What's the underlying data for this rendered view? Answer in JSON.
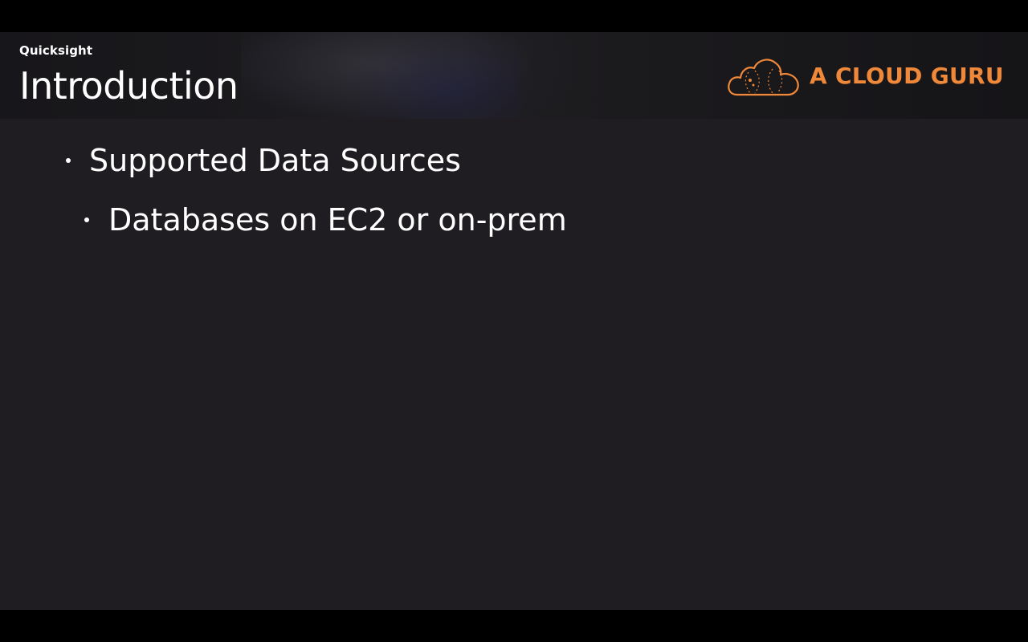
{
  "slide": {
    "course": "Quicksight",
    "title": "Introduction",
    "brand": {
      "name": "A CLOUD GURU",
      "icon": "cloud-logo-icon",
      "color": "#f0883a"
    },
    "bullets": [
      {
        "level": 1,
        "text": "Supported Data Sources"
      },
      {
        "level": 2,
        "text": "Databases on EC2 or on-prem"
      }
    ]
  },
  "colors": {
    "background": "#1f1d21",
    "letterbox": "#000000",
    "text": "#ffffff"
  }
}
